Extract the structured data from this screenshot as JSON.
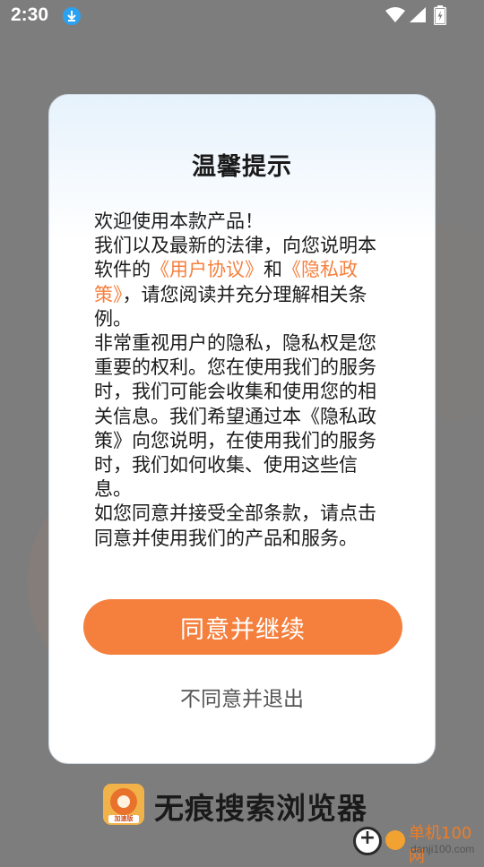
{
  "status_bar": {
    "time": "2:30"
  },
  "dialog": {
    "title": "温馨提示",
    "body": {
      "p1": "欢迎使用本款产品！",
      "p2_a": "我们以及最新的法律，向您说明本软件的",
      "p2_link1": "《用户协议》",
      "p2_b": "和",
      "p2_link2": "《隐私政策》",
      "p2_c": "，请您阅读并充分理解相关条例。",
      "p3": "非常重视用户的隐私，隐私权是您重要的权利。您在使用我们的服务时，我们可能会收集和使用您的相关信息。我们希望通过本《隐私政策》向您说明，在使用我们的服务时，我们如何收集、使用这些信息。",
      "p4": "如您同意并接受全部条款，请点击同意并使用我们的产品和服务。"
    },
    "agree_label": "同意并继续",
    "disagree_label": "不同意并退出"
  },
  "branding": {
    "logo_tag": "加速版",
    "app_name": "无痕搜索浏览器"
  },
  "watermark": {
    "site_name": "单机100网",
    "site_url": "danji100.com"
  },
  "colors": {
    "accent": "#f5803e",
    "overlay": "#7d7d7d"
  }
}
